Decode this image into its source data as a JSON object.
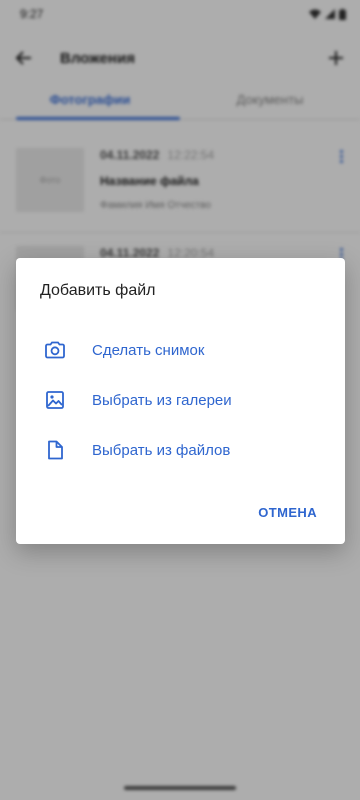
{
  "status_bar": {
    "time": "9:27"
  },
  "app_bar": {
    "title": "Вложения"
  },
  "tabs": [
    {
      "label": "Фотографии",
      "active": true
    },
    {
      "label": "Документы",
      "active": false
    }
  ],
  "list": [
    {
      "date": "04.11.2022",
      "time": "12:22:54",
      "file_name": "Название файла",
      "author": "Фамилия Имя Отчество",
      "thumb_label": "Фото"
    },
    {
      "date": "04.11.2022",
      "time": "12:20:54"
    }
  ],
  "dialog": {
    "title": "Добавить файл",
    "options": [
      {
        "label": "Сделать снимок",
        "icon": "camera-icon"
      },
      {
        "label": "Выбрать из галереи",
        "icon": "image-icon"
      },
      {
        "label": "Выбрать из файлов",
        "icon": "file-icon"
      }
    ],
    "cancel_label": "ОТМЕНА"
  },
  "colors": {
    "accent": "#2f66cf",
    "scrim": "rgba(0,0,0,0.32)"
  }
}
